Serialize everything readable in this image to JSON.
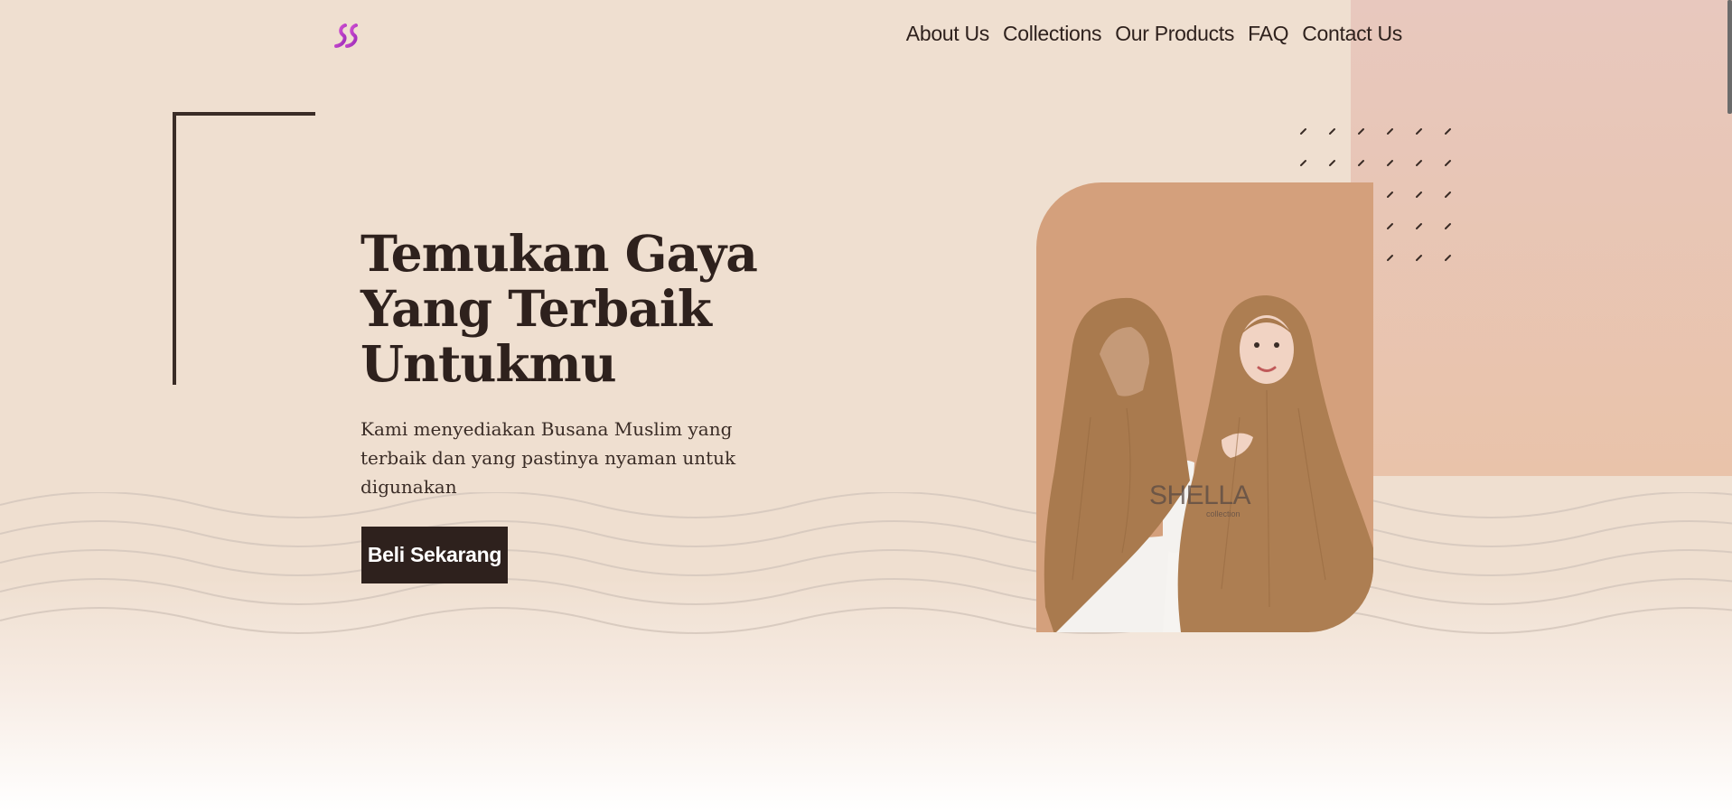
{
  "nav": {
    "items": [
      {
        "label": "About Us"
      },
      {
        "label": "Collections"
      },
      {
        "label": "Our Products"
      },
      {
        "label": "FAQ"
      },
      {
        "label": "Contact Us"
      }
    ]
  },
  "hero": {
    "title": "Temukan Gaya Yang Terbaik Untukmu",
    "description": "Kami menyediakan Busana Muslim yang terbaik dan yang pastinya nyaman untuk digunakan",
    "cta_label": "Beli Sekarang"
  },
  "product_image": {
    "brand_text": "SHELLA",
    "brand_subtext": "collection"
  },
  "colors": {
    "background": "#efdfd0",
    "accent_dark": "#2e211d",
    "pink_block": "#e8c8be",
    "photo_bg": "#d4a07c",
    "logo_accent": "#c040c8"
  },
  "icons": {
    "logo": "brand-s-logo-icon"
  }
}
